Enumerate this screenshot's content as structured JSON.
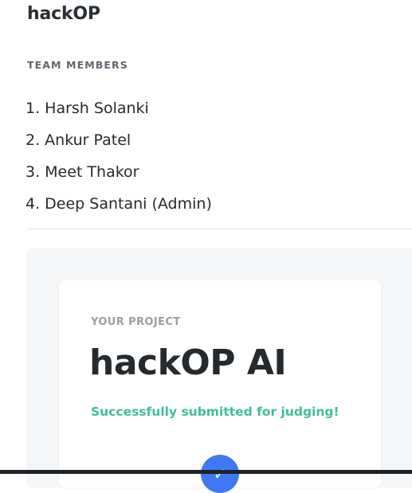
{
  "team": {
    "name": "hackOP",
    "members_heading": "TEAM MEMBERS",
    "members": [
      "1. Harsh Solanki",
      "2. Ankur Patel",
      "3. Meet Thakor",
      "4. Deep Santani (Admin)"
    ]
  },
  "project": {
    "heading": "YOUR PROJECT",
    "title": "hackOP AI",
    "status": "Successfully submitted for judging!",
    "status_icon": "checkmark-icon",
    "status_color": "#3fbf9a",
    "badge_color": "#3f78f2"
  }
}
